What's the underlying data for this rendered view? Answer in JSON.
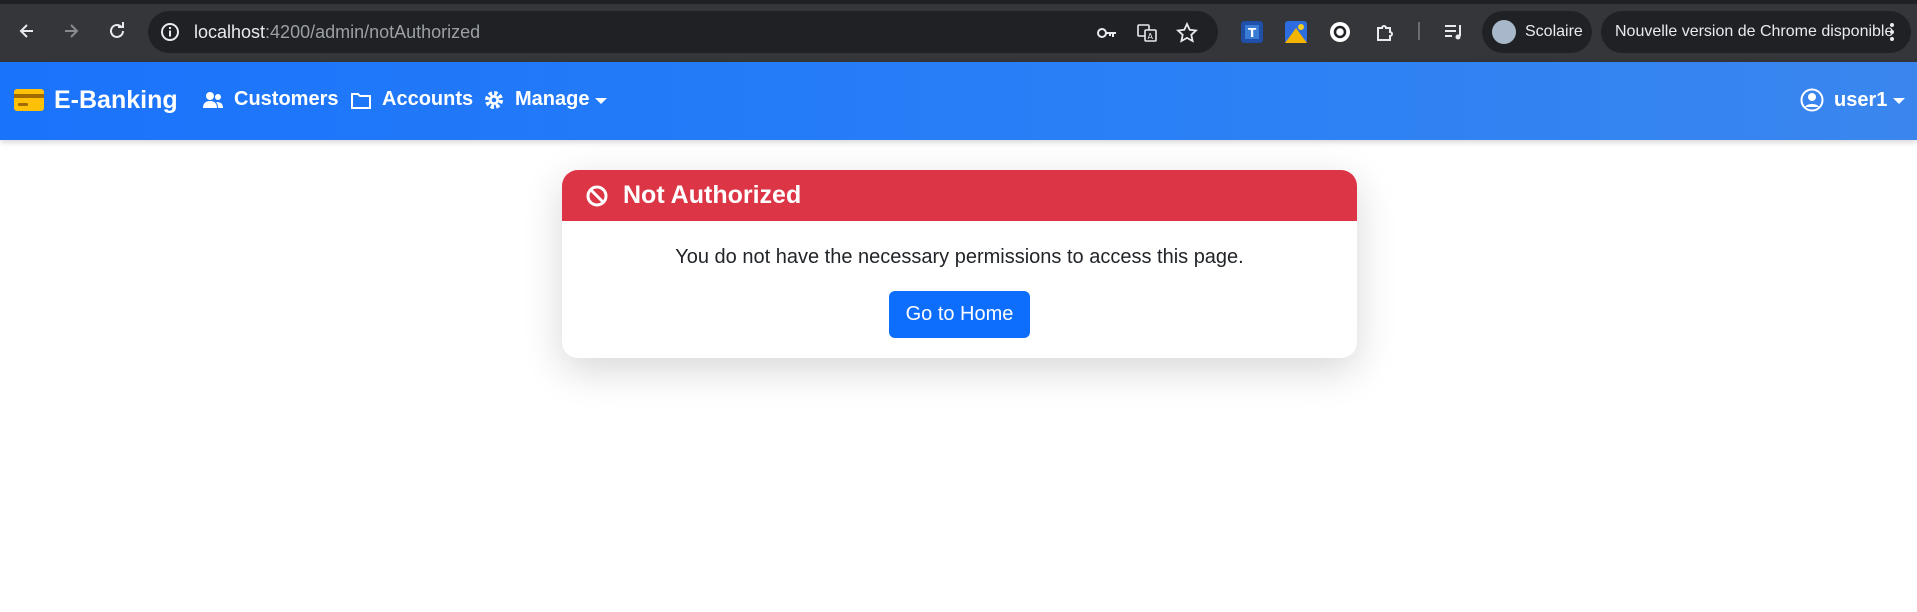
{
  "browser": {
    "url_host": "localhost",
    "url_path": ":4200/admin/notAuthorized",
    "profile_name": "Scolaire",
    "update_text": "Nouvelle version de Chrome disponible"
  },
  "navbar": {
    "brand": "E-Banking",
    "items": [
      {
        "label": "Customers",
        "icon": "users-icon"
      },
      {
        "label": "Accounts",
        "icon": "folder-icon"
      },
      {
        "label": "Manage",
        "icon": "gear-icon"
      }
    ],
    "user": "user1"
  },
  "alert": {
    "title": "Not Authorized",
    "message": "You do not have the necessary permissions to access this page.",
    "button": "Go to Home"
  },
  "colors": {
    "navbar": "#1a73fb",
    "danger": "#dc3545",
    "primary": "#0d6efd",
    "brand_icon": "#ffc107"
  }
}
